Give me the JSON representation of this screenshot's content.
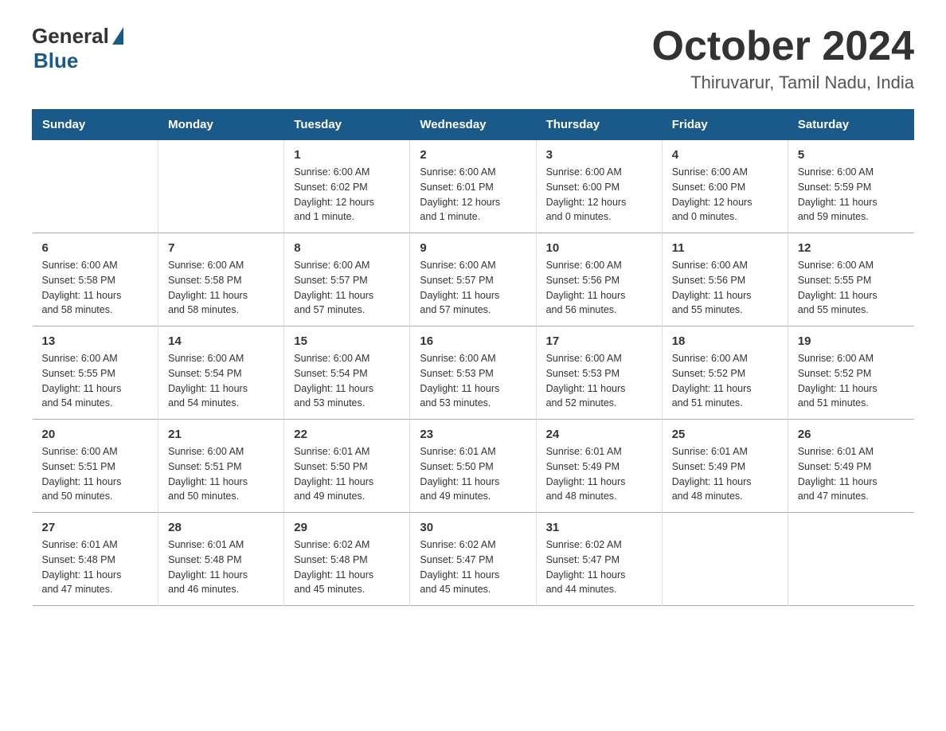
{
  "logo": {
    "general": "General",
    "blue": "Blue"
  },
  "title": "October 2024",
  "location": "Thiruvarur, Tamil Nadu, India",
  "headers": [
    "Sunday",
    "Monday",
    "Tuesday",
    "Wednesday",
    "Thursday",
    "Friday",
    "Saturday"
  ],
  "weeks": [
    [
      {
        "day": "",
        "info": ""
      },
      {
        "day": "",
        "info": ""
      },
      {
        "day": "1",
        "info": "Sunrise: 6:00 AM\nSunset: 6:02 PM\nDaylight: 12 hours\nand 1 minute."
      },
      {
        "day": "2",
        "info": "Sunrise: 6:00 AM\nSunset: 6:01 PM\nDaylight: 12 hours\nand 1 minute."
      },
      {
        "day": "3",
        "info": "Sunrise: 6:00 AM\nSunset: 6:00 PM\nDaylight: 12 hours\nand 0 minutes."
      },
      {
        "day": "4",
        "info": "Sunrise: 6:00 AM\nSunset: 6:00 PM\nDaylight: 12 hours\nand 0 minutes."
      },
      {
        "day": "5",
        "info": "Sunrise: 6:00 AM\nSunset: 5:59 PM\nDaylight: 11 hours\nand 59 minutes."
      }
    ],
    [
      {
        "day": "6",
        "info": "Sunrise: 6:00 AM\nSunset: 5:58 PM\nDaylight: 11 hours\nand 58 minutes."
      },
      {
        "day": "7",
        "info": "Sunrise: 6:00 AM\nSunset: 5:58 PM\nDaylight: 11 hours\nand 58 minutes."
      },
      {
        "day": "8",
        "info": "Sunrise: 6:00 AM\nSunset: 5:57 PM\nDaylight: 11 hours\nand 57 minutes."
      },
      {
        "day": "9",
        "info": "Sunrise: 6:00 AM\nSunset: 5:57 PM\nDaylight: 11 hours\nand 57 minutes."
      },
      {
        "day": "10",
        "info": "Sunrise: 6:00 AM\nSunset: 5:56 PM\nDaylight: 11 hours\nand 56 minutes."
      },
      {
        "day": "11",
        "info": "Sunrise: 6:00 AM\nSunset: 5:56 PM\nDaylight: 11 hours\nand 55 minutes."
      },
      {
        "day": "12",
        "info": "Sunrise: 6:00 AM\nSunset: 5:55 PM\nDaylight: 11 hours\nand 55 minutes."
      }
    ],
    [
      {
        "day": "13",
        "info": "Sunrise: 6:00 AM\nSunset: 5:55 PM\nDaylight: 11 hours\nand 54 minutes."
      },
      {
        "day": "14",
        "info": "Sunrise: 6:00 AM\nSunset: 5:54 PM\nDaylight: 11 hours\nand 54 minutes."
      },
      {
        "day": "15",
        "info": "Sunrise: 6:00 AM\nSunset: 5:54 PM\nDaylight: 11 hours\nand 53 minutes."
      },
      {
        "day": "16",
        "info": "Sunrise: 6:00 AM\nSunset: 5:53 PM\nDaylight: 11 hours\nand 53 minutes."
      },
      {
        "day": "17",
        "info": "Sunrise: 6:00 AM\nSunset: 5:53 PM\nDaylight: 11 hours\nand 52 minutes."
      },
      {
        "day": "18",
        "info": "Sunrise: 6:00 AM\nSunset: 5:52 PM\nDaylight: 11 hours\nand 51 minutes."
      },
      {
        "day": "19",
        "info": "Sunrise: 6:00 AM\nSunset: 5:52 PM\nDaylight: 11 hours\nand 51 minutes."
      }
    ],
    [
      {
        "day": "20",
        "info": "Sunrise: 6:00 AM\nSunset: 5:51 PM\nDaylight: 11 hours\nand 50 minutes."
      },
      {
        "day": "21",
        "info": "Sunrise: 6:00 AM\nSunset: 5:51 PM\nDaylight: 11 hours\nand 50 minutes."
      },
      {
        "day": "22",
        "info": "Sunrise: 6:01 AM\nSunset: 5:50 PM\nDaylight: 11 hours\nand 49 minutes."
      },
      {
        "day": "23",
        "info": "Sunrise: 6:01 AM\nSunset: 5:50 PM\nDaylight: 11 hours\nand 49 minutes."
      },
      {
        "day": "24",
        "info": "Sunrise: 6:01 AM\nSunset: 5:49 PM\nDaylight: 11 hours\nand 48 minutes."
      },
      {
        "day": "25",
        "info": "Sunrise: 6:01 AM\nSunset: 5:49 PM\nDaylight: 11 hours\nand 48 minutes."
      },
      {
        "day": "26",
        "info": "Sunrise: 6:01 AM\nSunset: 5:49 PM\nDaylight: 11 hours\nand 47 minutes."
      }
    ],
    [
      {
        "day": "27",
        "info": "Sunrise: 6:01 AM\nSunset: 5:48 PM\nDaylight: 11 hours\nand 47 minutes."
      },
      {
        "day": "28",
        "info": "Sunrise: 6:01 AM\nSunset: 5:48 PM\nDaylight: 11 hours\nand 46 minutes."
      },
      {
        "day": "29",
        "info": "Sunrise: 6:02 AM\nSunset: 5:48 PM\nDaylight: 11 hours\nand 45 minutes."
      },
      {
        "day": "30",
        "info": "Sunrise: 6:02 AM\nSunset: 5:47 PM\nDaylight: 11 hours\nand 45 minutes."
      },
      {
        "day": "31",
        "info": "Sunrise: 6:02 AM\nSunset: 5:47 PM\nDaylight: 11 hours\nand 44 minutes."
      },
      {
        "day": "",
        "info": ""
      },
      {
        "day": "",
        "info": ""
      }
    ]
  ]
}
